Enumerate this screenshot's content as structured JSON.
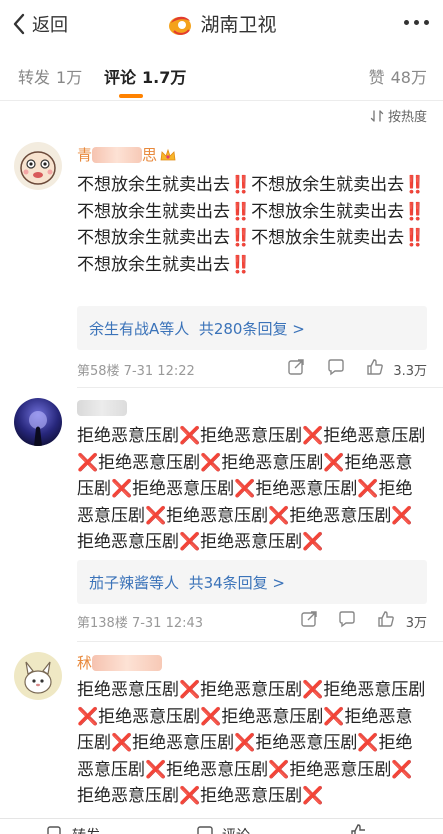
{
  "header": {
    "back_label": "返回",
    "title": "湖南卫视"
  },
  "tabs": {
    "repost_label": "转发",
    "repost_count": "1万",
    "comment_label": "评论",
    "comment_count": "1.7万",
    "like_label": "赞",
    "like_count": "48万"
  },
  "sort_label": "按热度",
  "comments": [
    {
      "name_visible": "青",
      "name_suffix": "思",
      "text": "不想放余生就卖出去‼️不想放余生就卖出去‼️不想放余生就卖出去‼️不想放余生就卖出去‼️不想放余生就卖出去‼️不想放余生就卖出去‼️不想放余生就卖出去‼️",
      "reply_users": "余生有战A等人",
      "reply_count": "共280条回复 >",
      "floor": "第58楼  7-31 12:22",
      "likes": "3.3万"
    },
    {
      "name_visible": "",
      "text": "拒绝恶意压剧❌拒绝恶意压剧❌拒绝恶意压剧❌拒绝恶意压剧❌拒绝恶意压剧❌拒绝恶意压剧❌拒绝恶意压剧❌拒绝恶意压剧❌拒绝恶意压剧❌拒绝恶意压剧❌拒绝恶意压剧❌拒绝恶意压剧❌拒绝恶意压剧❌",
      "reply_users": "茄子辣酱等人",
      "reply_count": "共34条回复 >",
      "floor": "第138楼  7-31 12:43",
      "likes": "3万"
    },
    {
      "name_visible": "秫",
      "text": "拒绝恶意压剧❌拒绝恶意压剧❌拒绝恶意压剧❌拒绝恶意压剧❌拒绝恶意压剧❌拒绝恶意压剧❌拒绝恶意压剧❌拒绝恶意压剧❌拒绝恶意压剧❌拒绝恶意压剧❌拒绝恶意压剧❌拒绝恶意压剧❌拒绝恶意压剧❌"
    }
  ],
  "bottom": {
    "repost_label": "转发",
    "comment_label": "评论"
  },
  "colors": {
    "accent": "#ff8200",
    "link": "#3b73b9",
    "reply_bg": "#f5f5f5"
  }
}
